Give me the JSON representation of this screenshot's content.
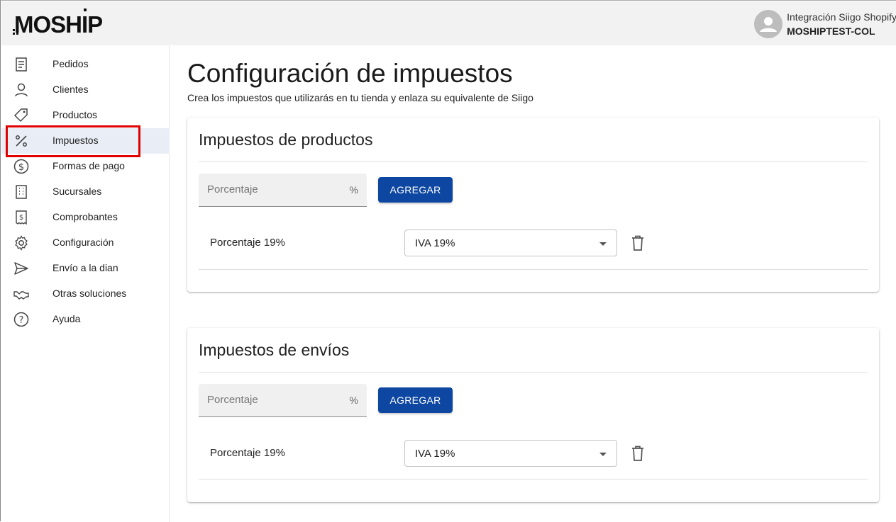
{
  "header": {
    "logo_text": "MOSHIP",
    "user_name": "Integración Siigo Shopify",
    "store_name": "MOSHIPTEST-COL"
  },
  "sidebar": {
    "items": [
      {
        "label": "Pedidos",
        "icon": "receipt-icon"
      },
      {
        "label": "Clientes",
        "icon": "person-icon"
      },
      {
        "label": "Productos",
        "icon": "tag-icon"
      },
      {
        "label": "Impuestos",
        "icon": "percent-icon",
        "active": true
      },
      {
        "label": "Formas de pago",
        "icon": "dollar-circle-icon"
      },
      {
        "label": "Sucursales",
        "icon": "building-icon"
      },
      {
        "label": "Comprobantes",
        "icon": "receipt-dollar-icon"
      },
      {
        "label": "Configuración",
        "icon": "gear-icon"
      },
      {
        "label": "Envío a la dian",
        "icon": "send-icon"
      },
      {
        "label": "Otras soluciones",
        "icon": "handshake-icon"
      },
      {
        "label": "Ayuda",
        "icon": "help-circle-icon"
      }
    ]
  },
  "main": {
    "title": "Configuración de impuestos",
    "subtitle": "Crea los impuestos que utilizarás en tu tienda y enlaza su equivalente de Siigo",
    "sections": [
      {
        "title": "Impuestos de productos",
        "input_placeholder": "Porcentaje",
        "input_suffix": "%",
        "add_label": "AGREGAR",
        "rows": [
          {
            "label": "Porcentaje 19%",
            "selected": "IVA 19%"
          }
        ]
      },
      {
        "title": "Impuestos de envíos",
        "input_placeholder": "Porcentaje",
        "input_suffix": "%",
        "add_label": "AGREGAR",
        "rows": [
          {
            "label": "Porcentaje 19%",
            "selected": "IVA 19%"
          }
        ]
      }
    ]
  },
  "colors": {
    "primary_button": "#0d47a1",
    "active_nav_bg": "#e9edf5",
    "highlight_border": "#e00000"
  }
}
